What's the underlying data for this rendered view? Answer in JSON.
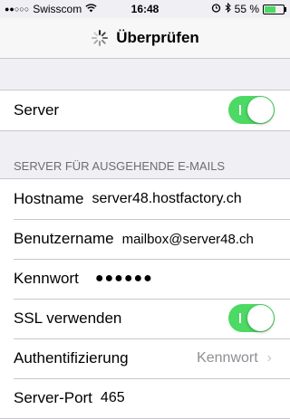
{
  "status_bar": {
    "carrier_signal": "●●○○○",
    "carrier": "Swisscom",
    "time": "16:48",
    "battery_percent": "55 %"
  },
  "nav": {
    "title": "Überprüfen"
  },
  "server_group": {
    "server_label": "Server",
    "server_enabled": true
  },
  "outgoing_section": {
    "header": "SERVER FÜR AUSGEHENDE E-MAILS",
    "hostname_label": "Hostname",
    "hostname_value": "server48.hostfactory.ch",
    "username_label": "Benutzername",
    "username_value": "mailbox@server48.ch",
    "password_label": "Kennwort",
    "password_value": "●●●●●●",
    "ssl_label": "SSL verwenden",
    "ssl_enabled": true,
    "auth_label": "Authentifizierung",
    "auth_value": "Kennwort",
    "port_label": "Server-Port",
    "port_value": "465"
  },
  "colors": {
    "toggle_on": "#4cd964",
    "background": "#efeff4",
    "secondary_text": "#8e8e93"
  }
}
